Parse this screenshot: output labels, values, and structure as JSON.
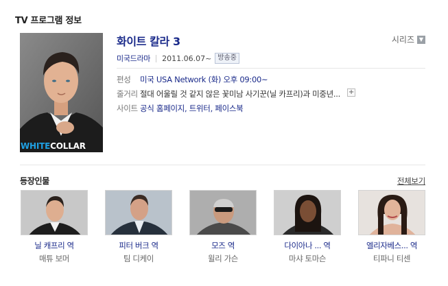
{
  "section_title": "TV 프로그램 정보",
  "poster": {
    "logo_white": "WHITE",
    "logo_collar": "COLLAR"
  },
  "program": {
    "title": "화이트 칼라 3",
    "series_label": "시리즈",
    "genre": "미국드라마",
    "date": "2011.06.07~",
    "status_badge": "방송중"
  },
  "info": {
    "broadcast_label": "편성",
    "broadcast_value": "미국 USA Network (화) 오후 09:00~",
    "synopsis_label": "줄거리",
    "synopsis_value": "절대 어울릴 것 같지 않은 꽃미남 사기꾼(닐 카프리)과 미중년...",
    "site_label": "사이트",
    "site_value": "공식 홈페이지, 트위터, 페이스북"
  },
  "cast": {
    "title": "등장인물",
    "view_all": "전체보기",
    "members": [
      {
        "role": "닐 캐프리 역",
        "actor": "매튜 보머"
      },
      {
        "role": "피터 버크 역",
        "actor": "팀 디케이"
      },
      {
        "role": "모즈 역",
        "actor": "윌리 가슨"
      },
      {
        "role": "다이아나 ... 역",
        "actor": "마샤 토마슨"
      },
      {
        "role": "엘리자베스... 역",
        "actor": "티파니 티센"
      }
    ]
  },
  "colors": {
    "link": "#1a2a8a",
    "label": "#777777",
    "rule": "#e6e6e6",
    "logo_accent": "#1fa0e3"
  },
  "icons": [
    "chevron-down-icon",
    "plus-icon"
  ]
}
